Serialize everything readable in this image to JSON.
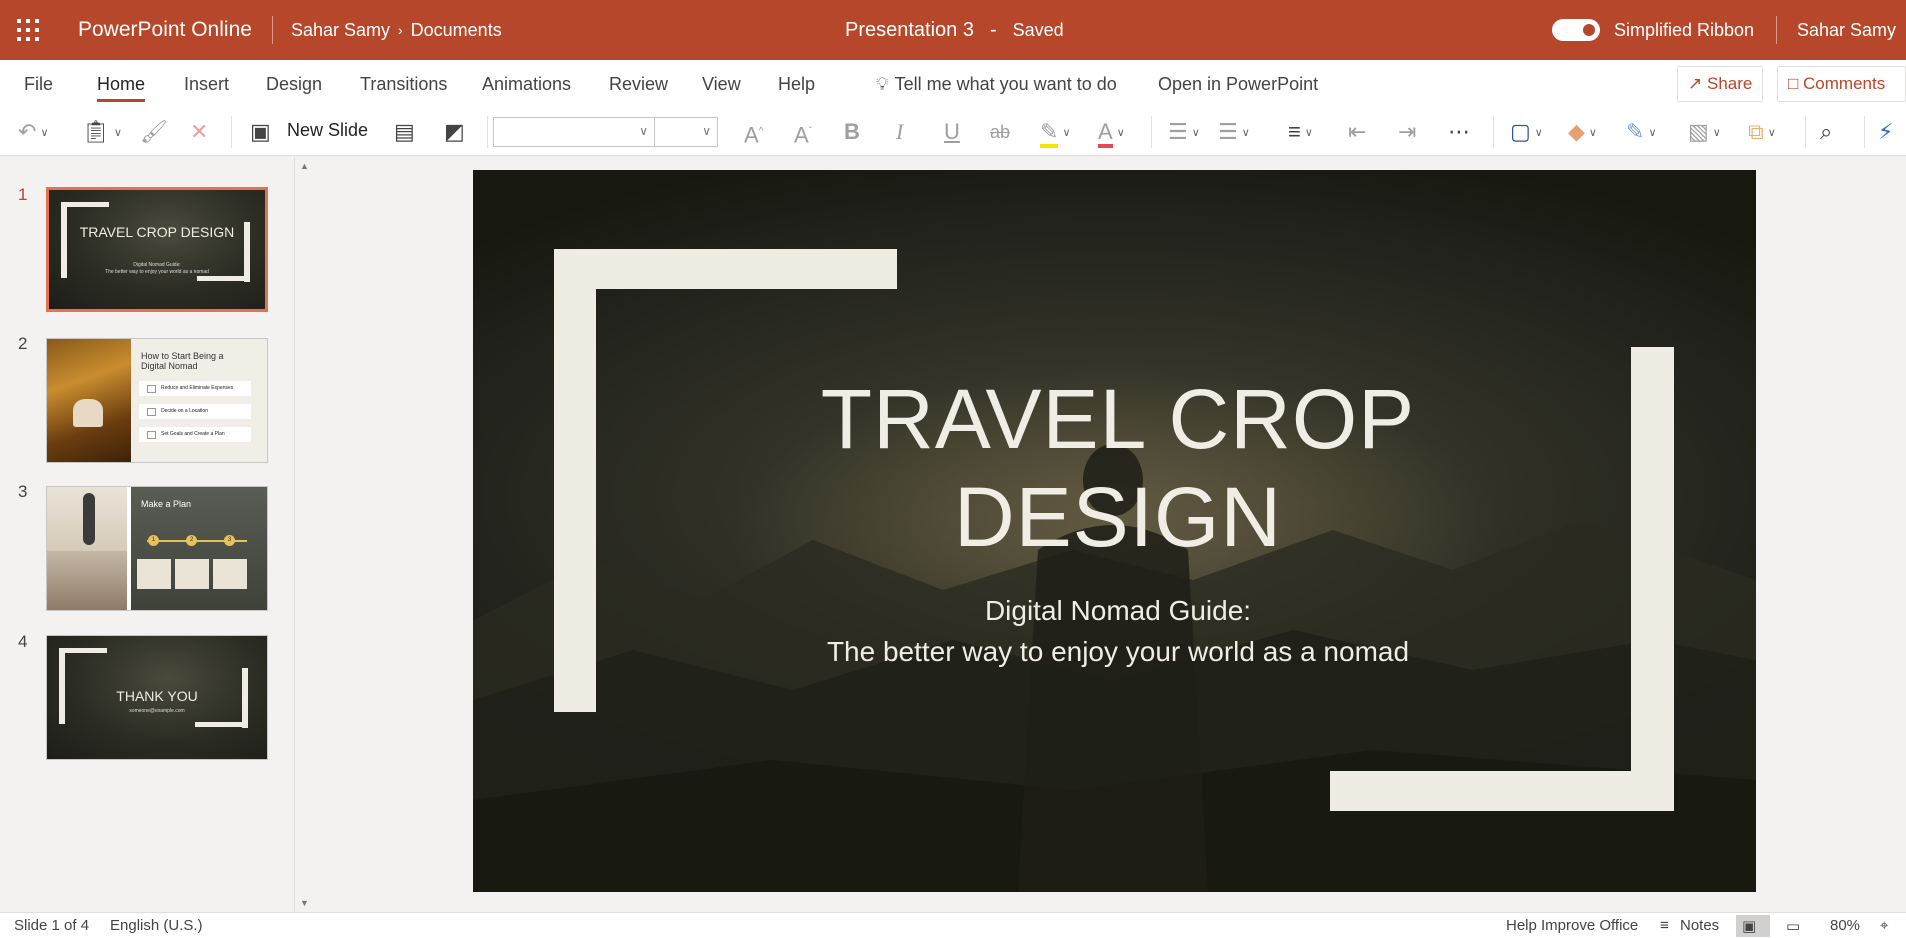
{
  "app": {
    "name": "PowerPoint Online"
  },
  "breadcrumb": {
    "user": "Sahar Samy",
    "folder": "Documents"
  },
  "document": {
    "title": "Presentation 3",
    "separator": "-",
    "status": "Saved"
  },
  "header": {
    "simplified_ribbon_label": "Simplified Ribbon",
    "simplified_ribbon_on": true,
    "user_name": "Sahar Samy"
  },
  "tabs": [
    "File",
    "Home",
    "Insert",
    "Design",
    "Transitions",
    "Animations",
    "Review",
    "View",
    "Help"
  ],
  "active_tab": "Home",
  "tell_me": "Tell me what you want to do",
  "open_in_app": "Open in PowerPoint",
  "share_label": "Share",
  "comments_label": "Comments",
  "ribbon": {
    "new_slide_label": "New Slide",
    "font_name": "",
    "font_size": ""
  },
  "icons": [
    "waffle-icon",
    "undo-icon",
    "clipboard-icon",
    "format-painter-icon",
    "clear-icon",
    "new-slide-icon",
    "layout-icon",
    "background-icon",
    "grow-font-icon",
    "shrink-font-icon",
    "bold-icon",
    "italic-icon",
    "underline-icon",
    "strikethrough-icon",
    "highlight-icon",
    "font-color-icon",
    "bullets-icon",
    "numbering-icon",
    "align-icon",
    "decrease-indent-icon",
    "increase-indent-icon",
    "more-icon",
    "shapes-icon",
    "shape-fill-icon",
    "shape-outline-icon",
    "picture-icon",
    "arrange-icon",
    "search-icon",
    "designer-icon"
  ],
  "colors": {
    "brand": "#b7472a",
    "slide_accent": "#efece3",
    "highlight": "#f2e500",
    "font_color": "#e74856"
  },
  "slides": [
    {
      "number": "1",
      "title": "TRAVEL CROP DESIGN",
      "subtitle_line1": "Digital Nomad Guide:",
      "subtitle_line2": "The better way to enjoy your world as a nomad"
    },
    {
      "number": "2",
      "title": "How to Start Being a Digital Nomad",
      "items": [
        "Reduce and Eliminate Expenses",
        "Decide on a Location",
        "Set Goals and Create a Plan"
      ]
    },
    {
      "number": "3",
      "title": "Make a Plan",
      "steps": [
        "1",
        "2",
        "3"
      ]
    },
    {
      "number": "4",
      "title": "THANK YOU",
      "subtitle": "someone@example.com"
    }
  ],
  "main_slide": {
    "title_line1": "TRAVEL CROP",
    "title_line2": "DESIGN",
    "subtitle_line1": "Digital Nomad Guide:",
    "subtitle_line2": "The better way to enjoy your world as a nomad"
  },
  "status_bar": {
    "slide_position": "Slide 1 of 4",
    "language": "English (U.S.)",
    "help_improve": "Help Improve Office",
    "notes_label": "Notes",
    "zoom": "80%"
  }
}
